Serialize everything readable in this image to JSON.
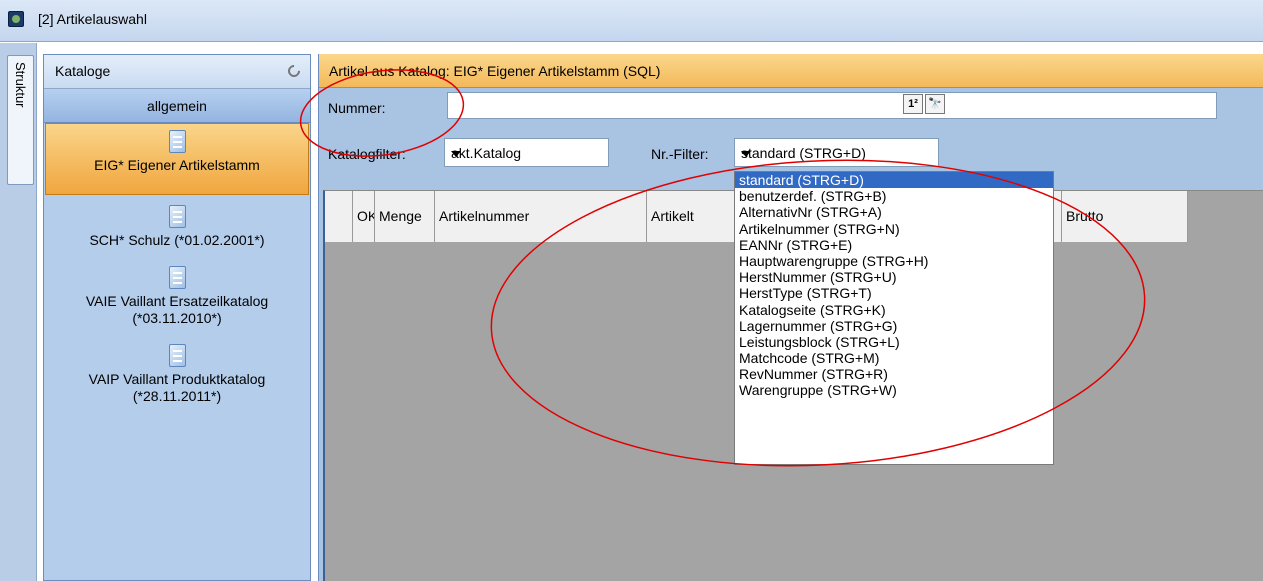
{
  "window": {
    "title": "[2] Artikelauswahl"
  },
  "strip": {
    "tab_label": "Struktur"
  },
  "catalog_panel": {
    "header": "Kataloge",
    "tab": "allgemein",
    "items": [
      {
        "line1": "EIG* Eigener Artikelstamm",
        "line2": ""
      },
      {
        "line1": "SCH* Schulz (*01.02.2001*)",
        "line2": ""
      },
      {
        "line1": "VAIE Vaillant Ersatzeilkatalog",
        "line2": "(*03.11.2010*)"
      },
      {
        "line1": "VAIP Vaillant Produktkatalog",
        "line2": "(*28.11.2011*)"
      }
    ]
  },
  "main": {
    "header": "Artikel aus Katalog: EIG* Eigener Artikelstamm (SQL)",
    "nummer_label": "Nummer:",
    "nummer_value": "",
    "katalogfilter_label": "Katalogfilter:",
    "katalogfilter_value": "akt.Katalog",
    "nrfilter_label": "Nr.-Filter:",
    "nrfilter_value": "standard (STRG+D)",
    "columns": [
      "",
      "OK",
      "Menge",
      "Artikelnummer",
      "Artikelt",
      "Brutto"
    ]
  },
  "dropdown": {
    "options": [
      "standard (STRG+D)",
      "benutzerdef. (STRG+B)",
      "AlternativNr (STRG+A)",
      "Artikelnummer (STRG+N)",
      "EANNr (STRG+E)",
      "Hauptwarengruppe (STRG+H)",
      "HerstNummer (STRG+U)",
      "HerstType (STRG+T)",
      "Katalogseite (STRG+K)",
      "Lagernummer (STRG+G)",
      "Leistungsblock (STRG+L)",
      "Matchcode (STRG+M)",
      "RevNummer (STRG+R)",
      "Warengruppe (STRG+W)"
    ],
    "selected_index": 0
  },
  "colors": {
    "accent_orange": "#f3b95a",
    "selection_blue": "#316ac5",
    "annotation_red": "#e00000"
  }
}
